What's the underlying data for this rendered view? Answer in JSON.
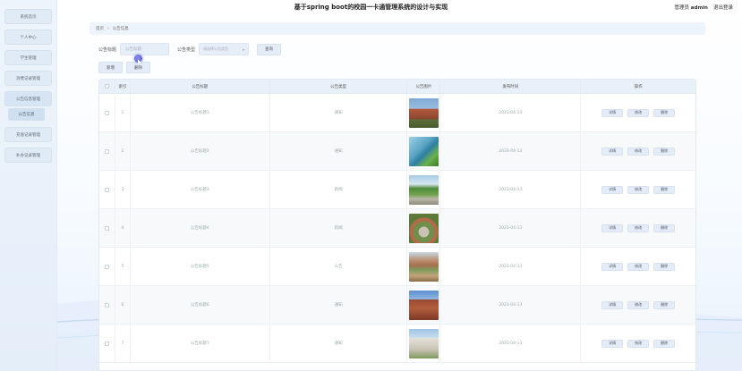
{
  "header": {
    "title": "基于spring boot的校园一卡通管理系统的设计与实现",
    "user_label": "管理员",
    "username": "admin",
    "logout": "退出登录"
  },
  "sidebar": {
    "items": [
      {
        "label": "系统首页"
      },
      {
        "label": "个人中心"
      },
      {
        "label": "学生管理"
      },
      {
        "label": "消费记录管理"
      },
      {
        "label": "公告信息管理"
      },
      {
        "label": "充值记录管理"
      },
      {
        "label": "补办记录管理"
      }
    ],
    "submenu_label": "公告信息"
  },
  "breadcrumb": {
    "home": "首页",
    "current": "公告信息"
  },
  "search": {
    "title_label": "公告标题",
    "title_placeholder": "公告标题",
    "type_label": "公告类型",
    "type_placeholder": "请选择公告类型",
    "query_button": "查询"
  },
  "actions": {
    "add": "新增",
    "delete": "删除"
  },
  "table": {
    "headers": [
      "索引",
      "公告标题",
      "公告类型",
      "公告图片",
      "发布时间",
      "操作"
    ],
    "rows": [
      {
        "index": "1",
        "title": "公告标题1",
        "type": "通知",
        "time": "2023-04-13",
        "img": "building-red"
      },
      {
        "index": "2",
        "title": "公告标题2",
        "type": "通知",
        "time": "2023-04-13",
        "img": "building-glass"
      },
      {
        "index": "3",
        "title": "公告标题3",
        "type": "新闻",
        "time": "2023-04-13",
        "img": "garden-walkway"
      },
      {
        "index": "4",
        "title": "公告标题4",
        "type": "新闻",
        "time": "2023-04-13",
        "img": "plaza-fountain"
      },
      {
        "index": "5",
        "title": "公告标题5",
        "type": "公告",
        "time": "2023-04-13",
        "img": "campus-aerial"
      },
      {
        "index": "6",
        "title": "公告标题6",
        "type": "通知",
        "time": "2023-04-13",
        "img": "brick-tower"
      },
      {
        "index": "7",
        "title": "公告标题7",
        "type": "通知",
        "time": "2023-04-13",
        "img": "white-building"
      }
    ],
    "row_actions": [
      "详情",
      "修改",
      "删除"
    ]
  }
}
